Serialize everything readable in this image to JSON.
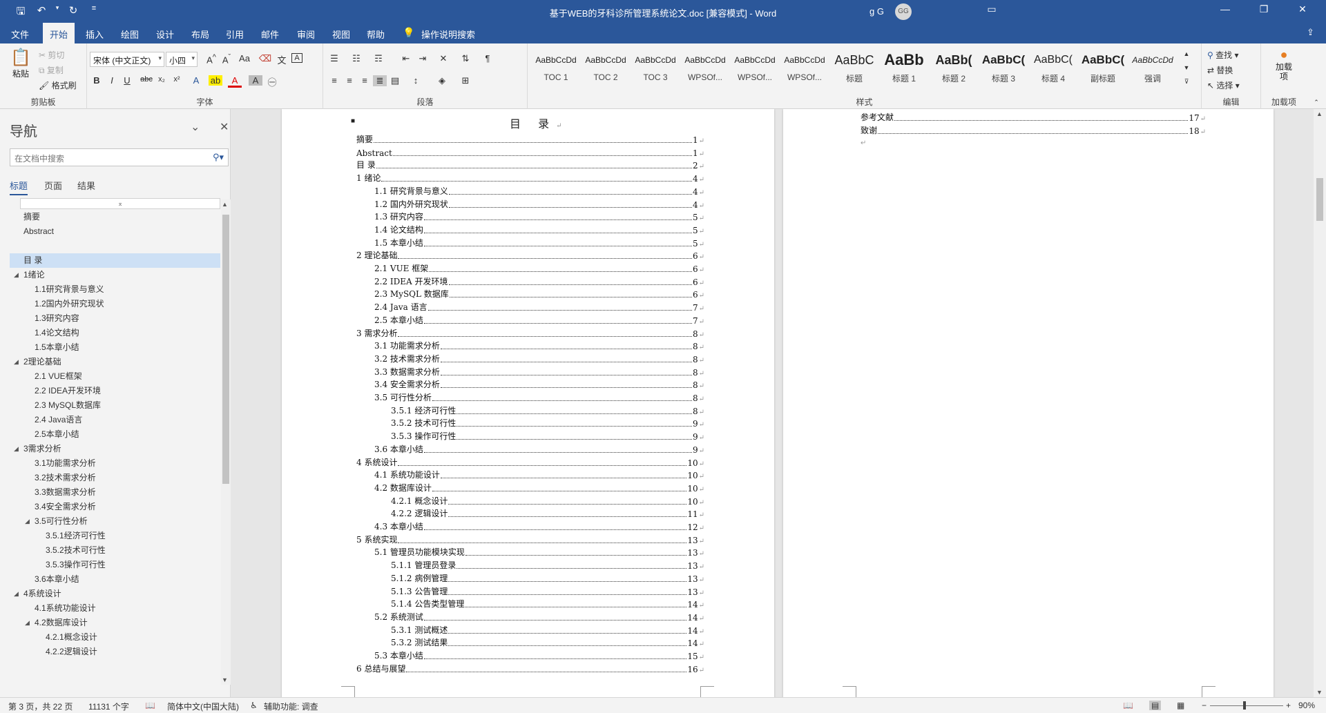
{
  "window": {
    "title": "基于WEB的牙科诊所管理系统论文.doc [兼容模式]  -  Word",
    "user_name": "g G",
    "user_initials": "GG",
    "accent": "#2b579a"
  },
  "qat": {
    "save_icon": "save-icon",
    "undo_icon": "undo-icon",
    "redo_icon": "redo-icon"
  },
  "tabs": [
    "文件",
    "开始",
    "插入",
    "绘图",
    "设计",
    "布局",
    "引用",
    "邮件",
    "审阅",
    "视图",
    "帮助"
  ],
  "tell_me": "操作说明搜索",
  "ribbon": {
    "clipboard": {
      "paste": "粘贴",
      "cut": "剪切",
      "copy": "复制",
      "format_painter": "格式刷",
      "label": "剪贴板"
    },
    "font": {
      "font_name": "宋体 (中文正文)",
      "font_size": "小四",
      "label": "字体"
    },
    "paragraph": {
      "label": "段落"
    },
    "styles": {
      "label": "样式",
      "items": [
        {
          "preview": "AaBbCcDd",
          "name": "TOC 1"
        },
        {
          "preview": "AaBbCcDd",
          "name": "TOC 2"
        },
        {
          "preview": "AaBbCcDd",
          "name": "TOC 3"
        },
        {
          "preview": "AaBbCcDd",
          "name": "WPSOf..."
        },
        {
          "preview": "AaBbCcDd",
          "name": "WPSOf..."
        },
        {
          "preview": "AaBbCcDd",
          "name": "WPSOf..."
        },
        {
          "preview": "AaBbC",
          "name": "标题"
        },
        {
          "preview": "AaBb",
          "name": "标题 1"
        },
        {
          "preview": "AaBb(",
          "name": "标题 2"
        },
        {
          "preview": "AaBbC(",
          "name": "标题 3"
        },
        {
          "preview": "AaBbC(",
          "name": "标题 4"
        },
        {
          "preview": "AaBbC(",
          "name": "副标题"
        },
        {
          "preview": "AaBbCcDd",
          "name": "强调"
        }
      ]
    },
    "editing": {
      "find": "查找",
      "replace": "替换",
      "select": "选择",
      "label": "编辑"
    },
    "addins": {
      "name": "加载项",
      "label": "加载项"
    }
  },
  "nav": {
    "title": "导航",
    "search_placeholder": "在文档中搜索",
    "tabs": [
      "标题",
      "页面",
      "结果"
    ],
    "items": [
      {
        "label": "摘要",
        "level": 0
      },
      {
        "label": "Abstract",
        "level": 0
      },
      {
        "label": "",
        "level": 0
      },
      {
        "label": "目  录",
        "level": 0,
        "selected": true
      },
      {
        "label": "1绪论",
        "level": 0,
        "expandable": true
      },
      {
        "label": "1.1研究背景与意义",
        "level": 1
      },
      {
        "label": "1.2国内外研究现状",
        "level": 1
      },
      {
        "label": "1.3研究内容",
        "level": 1
      },
      {
        "label": "1.4论文结构",
        "level": 1
      },
      {
        "label": "1.5本章小结",
        "level": 1
      },
      {
        "label": "2理论基础",
        "level": 0,
        "expandable": true
      },
      {
        "label": "2.1 VUE框架",
        "level": 1
      },
      {
        "label": "2.2 IDEA开发环境",
        "level": 1
      },
      {
        "label": "2.3 MySQL数据库",
        "level": 1
      },
      {
        "label": "2.4 Java语言",
        "level": 1
      },
      {
        "label": "2.5本章小结",
        "level": 1
      },
      {
        "label": "3需求分析",
        "level": 0,
        "expandable": true
      },
      {
        "label": "3.1功能需求分析",
        "level": 1
      },
      {
        "label": "3.2技术需求分析",
        "level": 1
      },
      {
        "label": "3.3数据需求分析",
        "level": 1
      },
      {
        "label": "3.4安全需求分析",
        "level": 1
      },
      {
        "label": "3.5可行性分析",
        "level": 1,
        "expandable": true
      },
      {
        "label": "3.5.1经济可行性",
        "level": 2
      },
      {
        "label": "3.5.2技术可行性",
        "level": 2
      },
      {
        "label": "3.5.3操作可行性",
        "level": 2
      },
      {
        "label": "3.6本章小结",
        "level": 1
      },
      {
        "label": "4系统设计",
        "level": 0,
        "expandable": true
      },
      {
        "label": "4.1系统功能设计",
        "level": 1
      },
      {
        "label": "4.2数据库设计",
        "level": 1,
        "expandable": true
      },
      {
        "label": "4.2.1概念设计",
        "level": 2
      },
      {
        "label": "4.2.2逻辑设计",
        "level": 2
      }
    ]
  },
  "document": {
    "toc_title": "目  录",
    "toc": [
      {
        "text": "摘要",
        "page": "1",
        "level": 0
      },
      {
        "text": "Abstract",
        "page": "1",
        "level": 0
      },
      {
        "text": "目  录",
        "page": "2",
        "level": 0
      },
      {
        "text": "1 绪论",
        "page": "4",
        "level": 0
      },
      {
        "text": "1.1 研究背景与意义",
        "page": "4",
        "level": 1
      },
      {
        "text": "1.2 国内外研究现状",
        "page": "4",
        "level": 1
      },
      {
        "text": "1.3 研究内容",
        "page": "5",
        "level": 1
      },
      {
        "text": "1.4 论文结构",
        "page": "5",
        "level": 1
      },
      {
        "text": "1.5 本章小结",
        "page": "5",
        "level": 1
      },
      {
        "text": "2 理论基础",
        "page": "6",
        "level": 0
      },
      {
        "text": "2.1 VUE 框架",
        "page": "6",
        "level": 1
      },
      {
        "text": "2.2 IDEA 开发环境",
        "page": "6",
        "level": 1
      },
      {
        "text": "2.3 MySQL 数据库",
        "page": "6",
        "level": 1
      },
      {
        "text": "2.4 Java 语言",
        "page": "7",
        "level": 1
      },
      {
        "text": "2.5 本章小结",
        "page": "7",
        "level": 1
      },
      {
        "text": "3 需求分析",
        "page": "8",
        "level": 0
      },
      {
        "text": "3.1 功能需求分析",
        "page": "8",
        "level": 1
      },
      {
        "text": "3.2 技术需求分析",
        "page": "8",
        "level": 1
      },
      {
        "text": "3.3 数据需求分析",
        "page": "8",
        "level": 1
      },
      {
        "text": "3.4 安全需求分析",
        "page": "8",
        "level": 1
      },
      {
        "text": "3.5 可行性分析",
        "page": "8",
        "level": 1
      },
      {
        "text": "3.5.1 经济可行性",
        "page": "8",
        "level": 2
      },
      {
        "text": "3.5.2 技术可行性",
        "page": "9",
        "level": 2
      },
      {
        "text": "3.5.3 操作可行性",
        "page": "9",
        "level": 2
      },
      {
        "text": "3.6 本章小结",
        "page": "9",
        "level": 1
      },
      {
        "text": "4 系统设计",
        "page": "10",
        "level": 0
      },
      {
        "text": "4.1 系统功能设计",
        "page": "10",
        "level": 1
      },
      {
        "text": "4.2 数据库设计",
        "page": "10",
        "level": 1
      },
      {
        "text": "4.2.1 概念设计",
        "page": "10",
        "level": 2
      },
      {
        "text": "4.2.2 逻辑设计",
        "page": "11",
        "level": 2
      },
      {
        "text": "4.3 本章小结",
        "page": "12",
        "level": 1
      },
      {
        "text": "5 系统实现",
        "page": "13",
        "level": 0
      },
      {
        "text": "5.1 管理员功能模块实现",
        "page": "13",
        "level": 1
      },
      {
        "text": "5.1.1 管理员登录",
        "page": "13",
        "level": 2
      },
      {
        "text": "5.1.2 病例管理",
        "page": "13",
        "level": 2
      },
      {
        "text": "5.1.3 公告管理",
        "page": "13",
        "level": 2
      },
      {
        "text": "5.1.4 公告类型管理",
        "page": "14",
        "level": 2
      },
      {
        "text": "5.2 系统测试",
        "page": "14",
        "level": 1
      },
      {
        "text": "5.3.1 测试概述",
        "page": "14",
        "level": 2
      },
      {
        "text": "5.3.2 测试结果",
        "page": "14",
        "level": 2
      },
      {
        "text": "5.3 本章小结",
        "page": "15",
        "level": 1
      },
      {
        "text": "6 总结与展望",
        "page": "16",
        "level": 0
      }
    ],
    "toc_page2": [
      {
        "text": "参考文献",
        "page": "17"
      },
      {
        "text": "致谢",
        "page": "18"
      }
    ]
  },
  "status": {
    "page_info": "第 3 页，共 22 页",
    "word_count": "11131 个字",
    "language": "简体中文(中国大陆)",
    "accessibility": "辅助功能: 调查",
    "zoom": "90%"
  }
}
